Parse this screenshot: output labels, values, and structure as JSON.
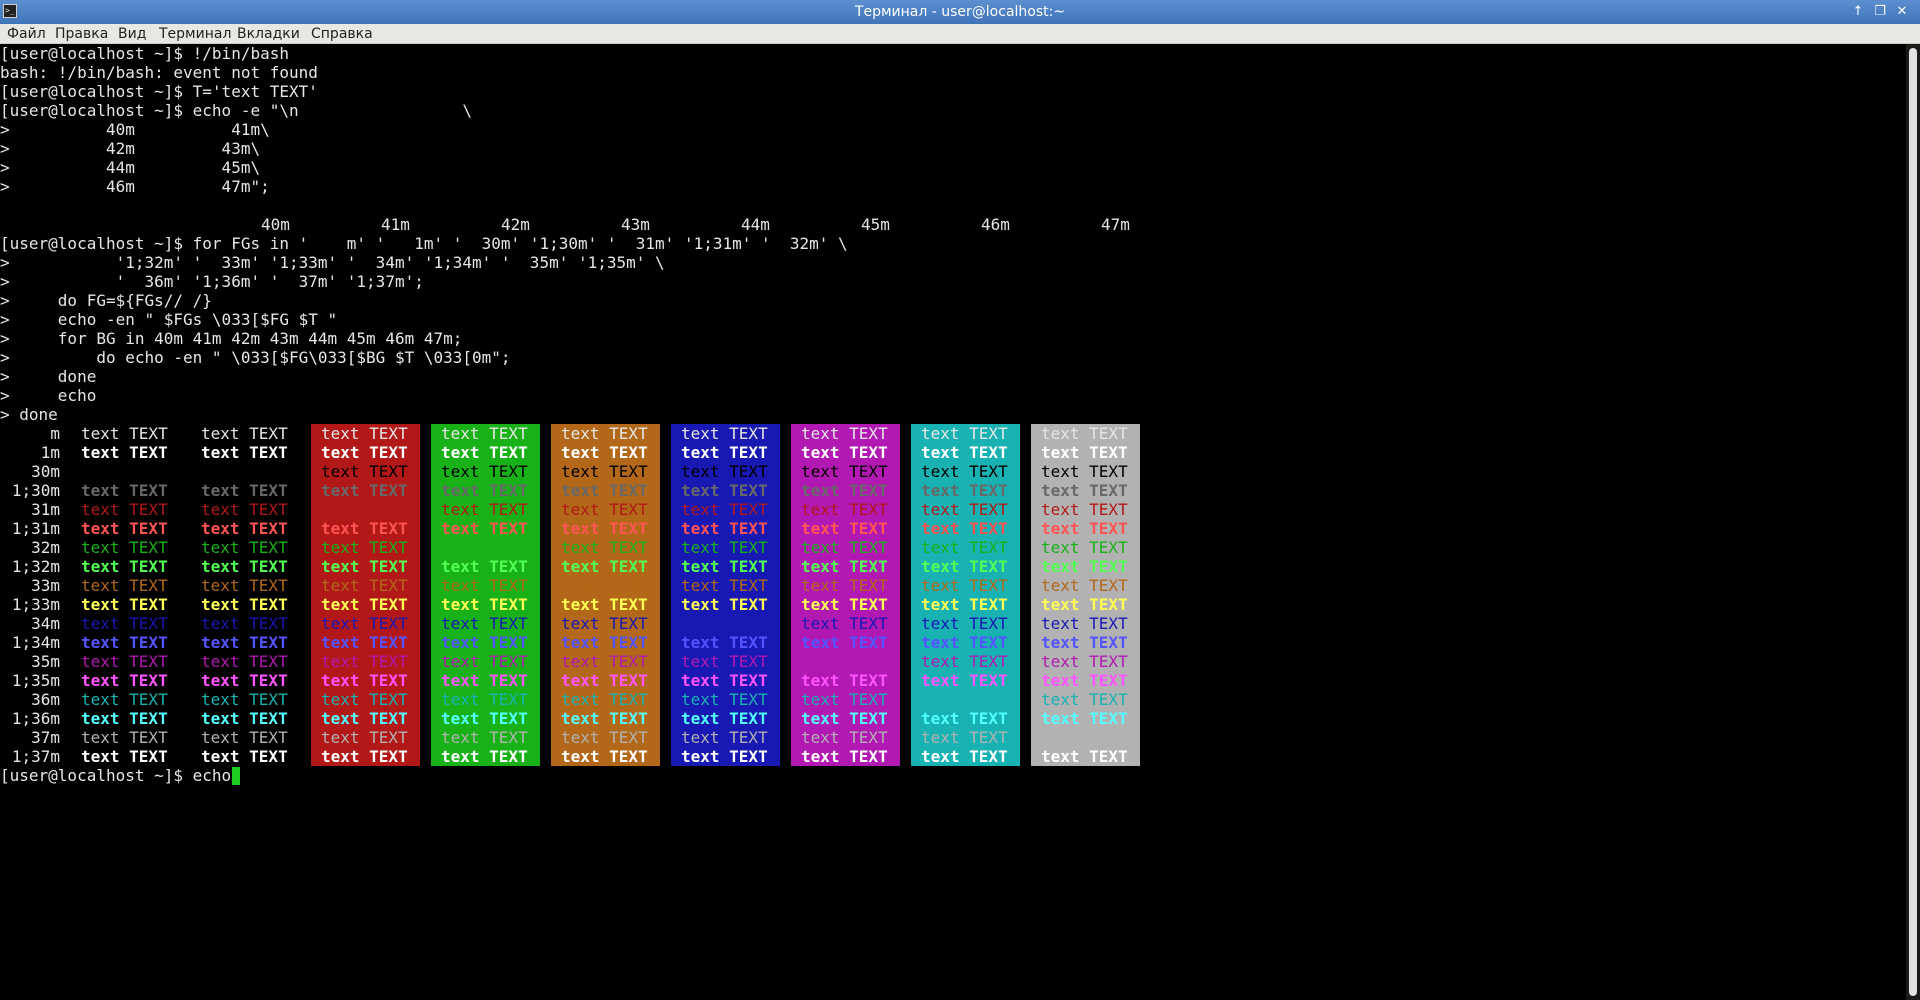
{
  "window": {
    "title": "Терминал - user@localhost:~",
    "icon": "terminal-app-icon",
    "controls": [
      "minimize-icon",
      "maximize-icon",
      "close-icon"
    ]
  },
  "menu": [
    "Файл",
    "Правка",
    "Вид",
    "Терминал",
    "Вкладки",
    "Справка"
  ],
  "terminal": {
    "lines_before": [
      "[user@localhost ~]$ !/bin/bash",
      "bash: !/bin/bash: event not found",
      "[user@localhost ~]$ T='text TEXT'",
      "[user@localhost ~]$ echo -e \"\\n                 \\",
      ">          40m          41m\\",
      ">          42m         43m\\",
      ">          44m         45m\\",
      ">          46m         47m\";",
      ""
    ],
    "header_labels": [
      "40m",
      "41m",
      "42m",
      "43m",
      "44m",
      "45m",
      "46m",
      "47m"
    ],
    "lines_after_header": [
      "[user@localhost ~]$ for FGs in '    m' '   1m' '  30m' '1;30m' '  31m' '1;31m' '  32m' \\",
      ">           '1;32m' '  33m' '1;33m' '  34m' '1;34m' '  35m' '1;35m' \\",
      ">           '  36m' '1;36m' '  37m' '1;37m';",
      ">     do FG=${FGs// /}",
      ">     echo -en \" $FGs \\033[$FG $T \"",
      ">     for BG in 40m 41m 42m 43m 44m 45m 46m 47m;",
      ">         do echo -en \" \\033[$FG\\033[$BG $T \\033[0m\";",
      ">     done",
      ">     echo",
      "> done"
    ],
    "cell_text": "text TEXT",
    "fg_labels": [
      "m",
      "1m",
      "30m",
      "1;30m",
      "31m",
      "1;31m",
      "32m",
      "1;32m",
      "33m",
      "1;33m",
      "34m",
      "1;34m",
      "35m",
      "1;35m",
      "36m",
      "1;36m",
      "37m",
      "1;37m"
    ],
    "prompt_line": "[user@localhost ~]$ echo",
    "colors": {
      "default_fg": "#e6e6e6",
      "bold_default_fg": "#ffffff",
      "fg": {
        "30": "#000000",
        "31": "#b21818",
        "32": "#18b218",
        "33": "#b26818",
        "34": "#1818b2",
        "35": "#b218b2",
        "36": "#18b2b2",
        "37": "#b2b2b2"
      },
      "fg_bold": {
        "30": "#686868",
        "31": "#ff5454",
        "32": "#54ff54",
        "33": "#ffff54",
        "34": "#5454ff",
        "35": "#ff54ff",
        "36": "#54ffff",
        "37": "#ffffff"
      },
      "bg": {
        "40": "#000000",
        "41": "#b21818",
        "42": "#18b218",
        "43": "#b26818",
        "44": "#1818b2",
        "45": "#b218b2",
        "46": "#18b2b2",
        "47": "#b2b2b2"
      },
      "cursor": "#1fcf1f"
    }
  }
}
